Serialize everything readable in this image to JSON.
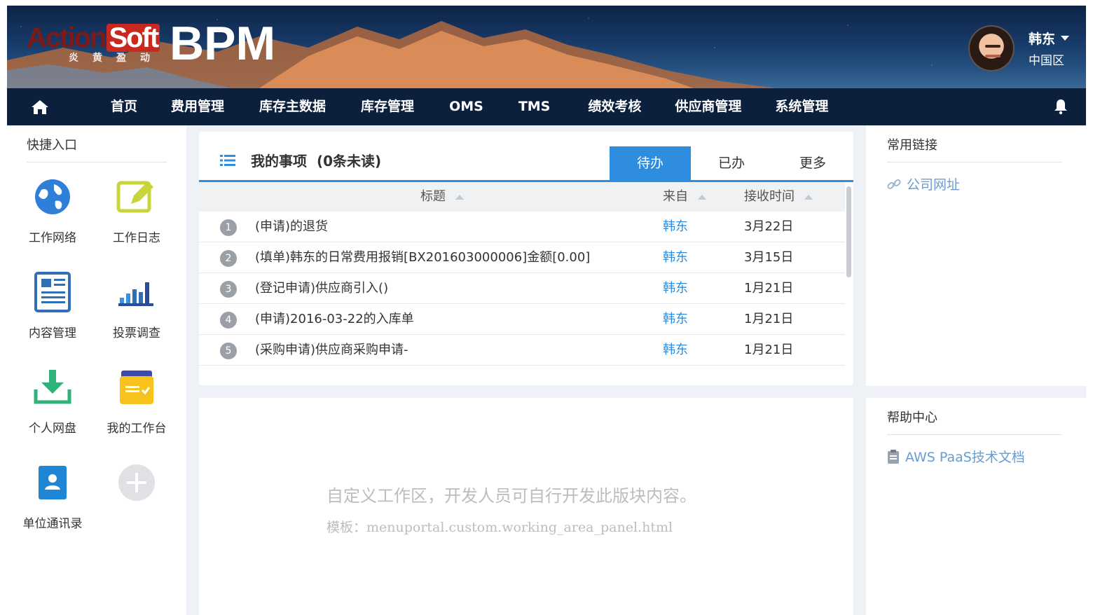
{
  "header": {
    "logo_primary": "Action",
    "logo_secondary": "Soft",
    "logo_tagline": "炎黄盈动",
    "product": "BPM",
    "user_name": "韩东",
    "user_region": "中国区"
  },
  "nav": {
    "items": [
      "首页",
      "费用管理",
      "库存主数据",
      "库存管理",
      "OMS",
      "TMS",
      "绩效考核",
      "供应商管理",
      "系统管理"
    ]
  },
  "quick": {
    "title": "快捷入口",
    "items": [
      "工作网络",
      "工作日志",
      "内容管理",
      "投票调查",
      "个人网盘",
      "我的工作台",
      "单位通讯录"
    ]
  },
  "tasks": {
    "title": "我的事项",
    "unread": "(0条未读)",
    "tabs": [
      "待办",
      "已办",
      "更多"
    ],
    "columns": [
      "标题",
      "来自",
      "接收时间"
    ],
    "rows": [
      {
        "n": "1",
        "title": "(申请)的退货",
        "from": "韩东",
        "date": "3月22日"
      },
      {
        "n": "2",
        "title": "(填单)韩东的日常费用报销[BX201603000006]金额[0.00]",
        "from": "韩东",
        "date": "3月15日"
      },
      {
        "n": "3",
        "title": "(登记申请)供应商引入()",
        "from": "韩东",
        "date": "1月21日"
      },
      {
        "n": "4",
        "title": "(申请)2016-03-22的入库单",
        "from": "韩东",
        "date": "1月21日"
      },
      {
        "n": "5",
        "title": "(采购申请)供应商采购申请-",
        "from": "韩东",
        "date": "1月21日"
      }
    ]
  },
  "custom": {
    "line1": "自定义工作区，开发人员可自行开发此版块内容。",
    "line2": "模板：menuportal.custom.working_area_panel.html"
  },
  "links": {
    "title": "常用链接",
    "item": "公司网址"
  },
  "help": {
    "title": "帮助中心",
    "item": "AWS PaaS技术文档"
  },
  "colors": {
    "accent": "#2e8ddf",
    "nav_bg": "#0c1f3d"
  }
}
